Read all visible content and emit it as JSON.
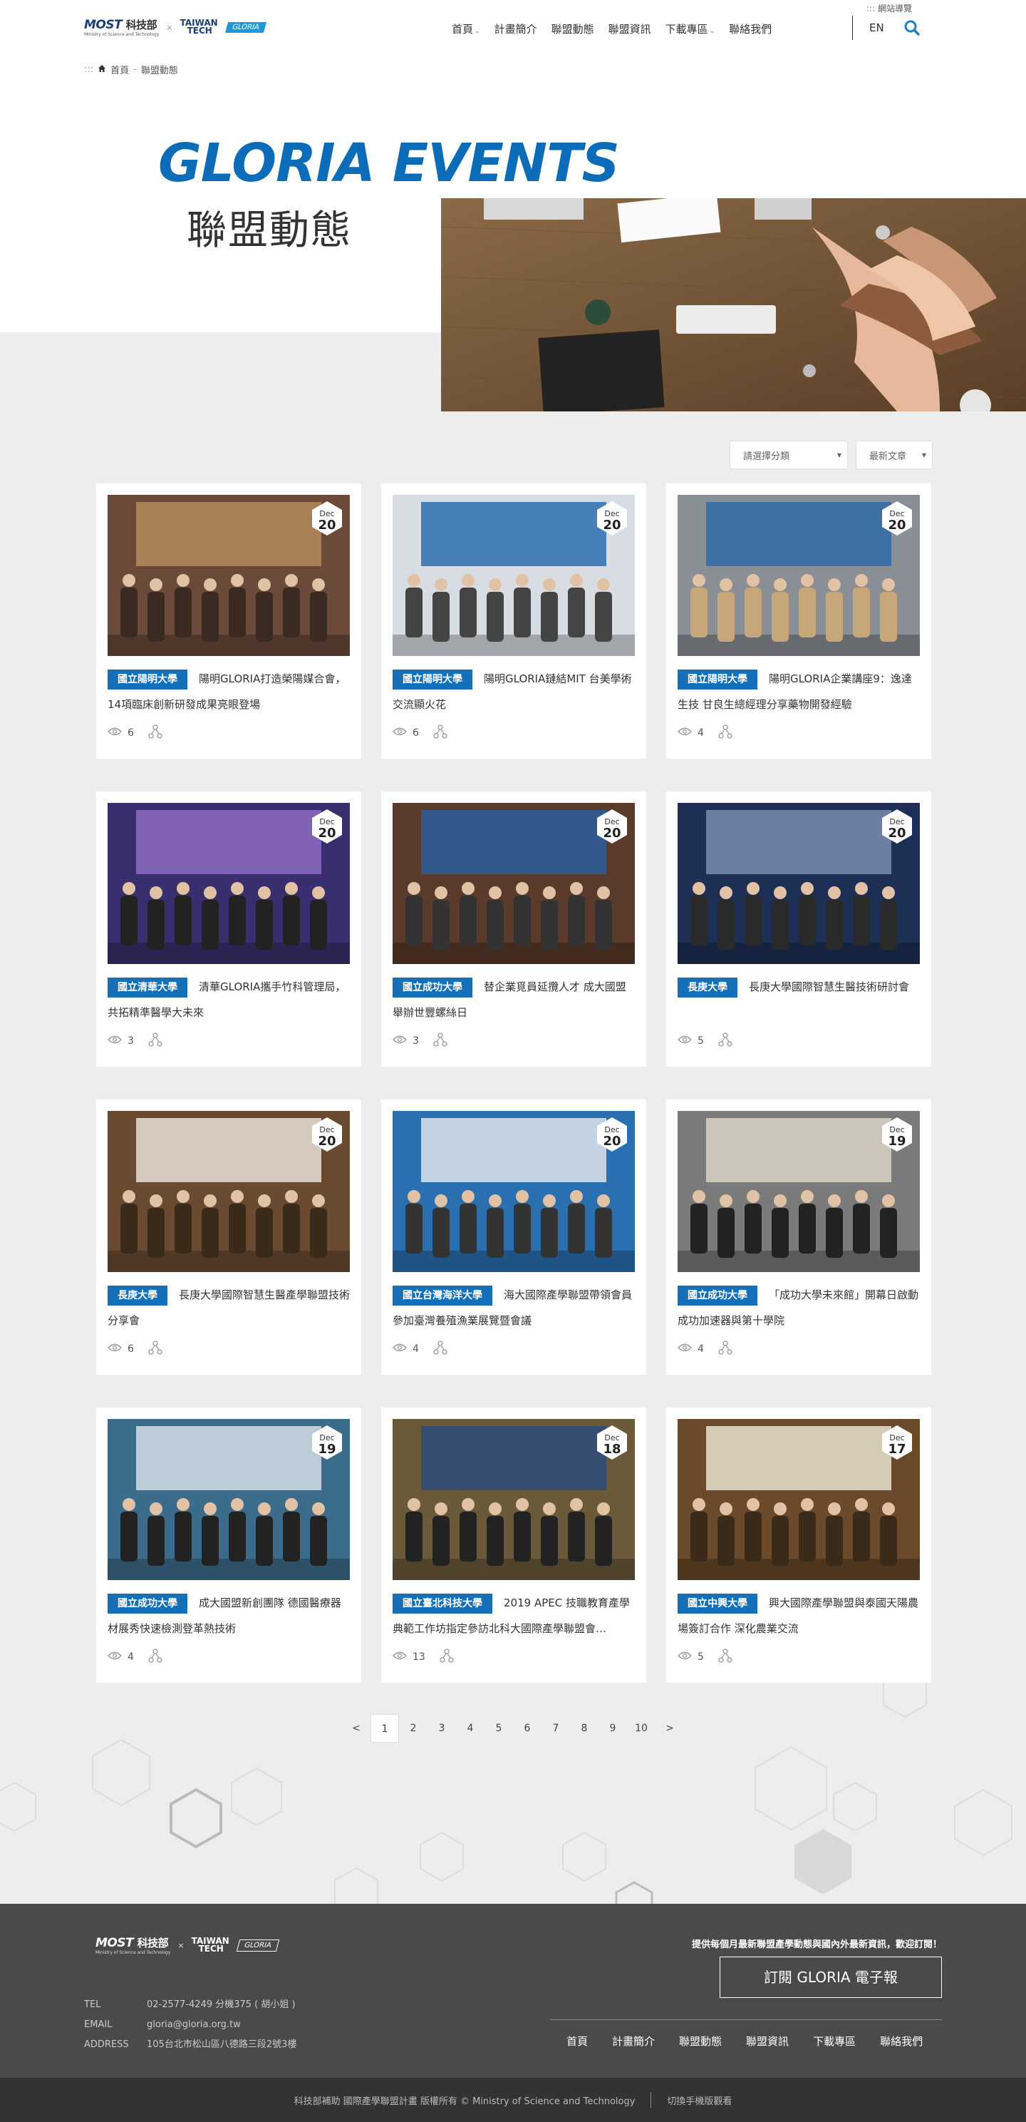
{
  "header": {
    "logo_most": "MOST",
    "logo_most_zh": "科技部",
    "logo_most_sub": "Ministry of Science and Technology",
    "logo_times": "×",
    "logo_tt_a": "TAIWAN",
    "logo_tt_b": "TECH",
    "logo_gloria": "GLORIA",
    "nav": [
      {
        "label": "首頁",
        "caret": "⌄"
      },
      {
        "label": "計畫簡介",
        "caret": ""
      },
      {
        "label": "聯盟動態",
        "caret": ""
      },
      {
        "label": "聯盟資訊",
        "caret": ""
      },
      {
        "label": "下載專區",
        "caret": "⌄"
      },
      {
        "label": "聯絡我們",
        "caret": ""
      }
    ],
    "sitemap_dots": ":::",
    "sitemap": "網站導覽",
    "lang": "EN"
  },
  "breadcrumb": {
    "dots": ":::",
    "home": "首頁",
    "sep": "-",
    "current": "聯盟動態"
  },
  "hero": {
    "title_en": "GLORIA EVENTS",
    "title_zh": "聯盟動態"
  },
  "filters": {
    "category": "請選擇分類",
    "sort": "最新文章"
  },
  "cards": [
    {
      "tag": "國立陽明大學",
      "title": "陽明GLORIA打造榮陽媒合會，14項臨床創新研發成果亮眼登場",
      "month": "Dec",
      "day": "20",
      "views": "6"
    },
    {
      "tag": "國立陽明大學",
      "title": "陽明GLORIA鏈結MIT 台美學術交流顯火花",
      "month": "Dec",
      "day": "20",
      "views": "6"
    },
    {
      "tag": "國立陽明大學",
      "title": "陽明GLORIA企業講座9：逸達生技 甘良生總經理分享藥物開發經驗",
      "month": "Dec",
      "day": "20",
      "views": "4"
    },
    {
      "tag": "國立清華大學",
      "title": "清華GLORIA攜手竹科管理局，共拓精準醫學大未來",
      "month": "Dec",
      "day": "20",
      "views": "3"
    },
    {
      "tag": "國立成功大學",
      "title": "替企業覓員延攬人才 成大國盟舉辦世豐螺絲日",
      "month": "Dec",
      "day": "20",
      "views": "3"
    },
    {
      "tag": "長庚大學",
      "title": "長庚大學國際智慧生醫技術研討會",
      "month": "Dec",
      "day": "20",
      "views": "5"
    },
    {
      "tag": "長庚大學",
      "title": "長庚大學國際智慧生醫產學聯盟技術分享會",
      "month": "Dec",
      "day": "20",
      "views": "6"
    },
    {
      "tag": "國立台灣海洋大學",
      "title": "海大國際產學聯盟帶領會員參加臺灣養殖漁業展覽暨會議",
      "month": "Dec",
      "day": "20",
      "views": "4"
    },
    {
      "tag": "國立成功大學",
      "title": "「成功大學未來館」開幕日啟動成功加速器與第十學院",
      "month": "Dec",
      "day": "19",
      "views": "4"
    },
    {
      "tag": "國立成功大學",
      "title": "成大國盟新創團隊 德國醫療器材展秀快速檢測登革熱技術",
      "month": "Dec",
      "day": "19",
      "views": "4"
    },
    {
      "tag": "國立臺北科技大學",
      "title": "2019 APEC 技職教育產學典範工作坊指定參訪北科大國際產學聯盟會…",
      "month": "Dec",
      "day": "18",
      "views": "13"
    },
    {
      "tag": "國立中興大學",
      "title": "興大國際產學聯盟與泰國天陽農場簽訂合作 深化農業交流",
      "month": "Dec",
      "day": "17",
      "views": "5"
    }
  ],
  "pagination": {
    "prev": "<",
    "pages": [
      "1",
      "2",
      "3",
      "4",
      "5",
      "6",
      "7",
      "8",
      "9",
      "10"
    ],
    "next": ">",
    "current": "1"
  },
  "footer": {
    "promo": "提供每個月最新聯盟產學動態與國內外最新資訊，歡迎訂閱！",
    "subscribe": "訂閱 GLORIA 電子報",
    "tel_label": "TEL",
    "tel": "02-2577-4249 分機375 ( 胡小姐 )",
    "email_label": "EMAIL",
    "email": "gloria@gloria.org.tw",
    "address_label": "ADDRESS",
    "address": "105台北市松山區八德路三段2號3樓",
    "nav": [
      "首頁",
      "計畫簡介",
      "聯盟動態",
      "聯盟資訊",
      "下載專區",
      "聯絡我們"
    ],
    "copyright": "科技部補助 國際產學聯盟計畫 版權所有 © Ministry of Science and Technology",
    "mobile": "切換手機版觀看"
  },
  "colors": {
    "brand_blue": "#0d6cb8",
    "tag_blue": "#1670b8",
    "footer_bg": "#4a4a4a",
    "page_gray": "#ededed"
  }
}
